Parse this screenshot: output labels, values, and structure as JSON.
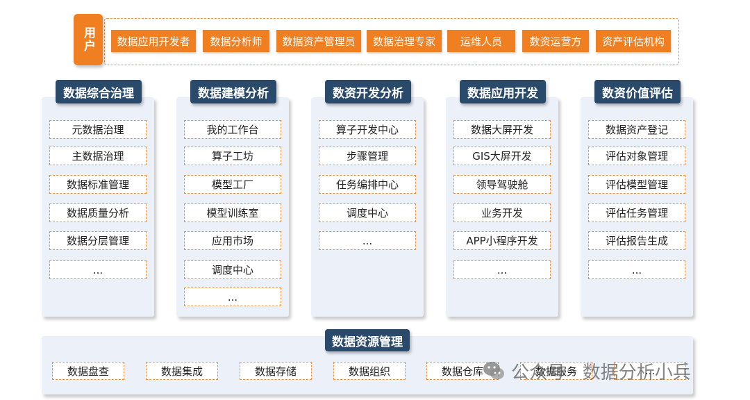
{
  "users": {
    "badge": "用户",
    "chips": [
      "数据应用开发者",
      "数据分析师",
      "数据资产管理员",
      "数据治理专家",
      "运维人员",
      "数资运营方",
      "资产评估机构"
    ]
  },
  "modules": [
    {
      "title": "数据综合治理",
      "items": [
        "元数据治理",
        "主数据治理",
        "数据标准管理",
        "数据质量分析",
        "数据分层管理",
        "..."
      ]
    },
    {
      "title": "数据建模分析",
      "items": [
        "我的工作台",
        "算子工坊",
        "模型工厂",
        "模型训练室",
        "应用市场",
        "调度中心",
        "..."
      ]
    },
    {
      "title": "数资开发分析",
      "items": [
        "算子开发中心",
        "步骤管理",
        "任务编排中心",
        "调度中心",
        "..."
      ]
    },
    {
      "title": "数据应用开发",
      "items": [
        "数据大屏开发",
        "GIS大屏开发",
        "领导驾驶舱",
        "业务开发",
        "APP小程序开发",
        "..."
      ]
    },
    {
      "title": "数资价值评估",
      "items": [
        "数据资产登记",
        "评估对象管理",
        "评估模型管理",
        "评估任务管理",
        "评估报告生成",
        "..."
      ]
    }
  ],
  "resources": {
    "title": "数据资源管理",
    "items": [
      "数据盘查",
      "数据集成",
      "数据存储",
      "数据组织",
      "数据仓库",
      "数据服务",
      "..."
    ]
  },
  "watermark": {
    "text": "公众号 · 数据分析小兵"
  }
}
